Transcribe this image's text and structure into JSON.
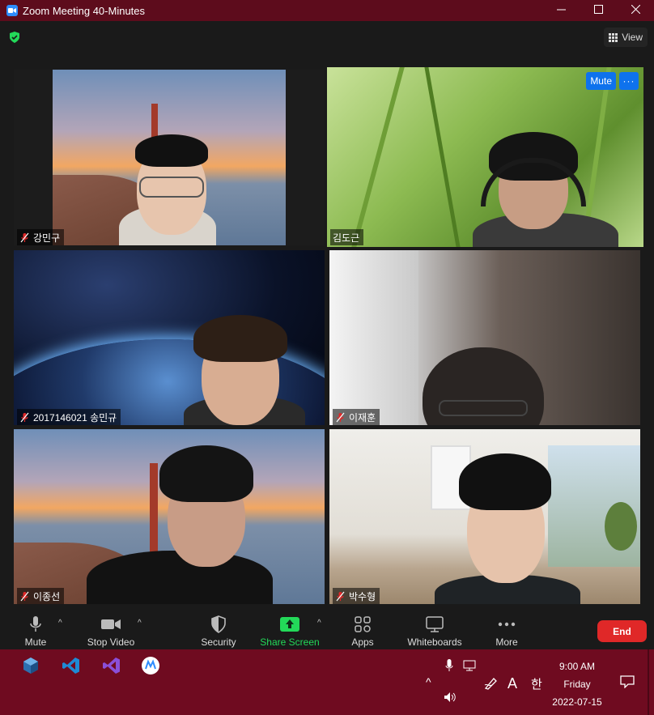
{
  "window": {
    "title": "Zoom Meeting 40-Minutes",
    "controls": [
      "minimize",
      "maximize",
      "close"
    ]
  },
  "header": {
    "view_label": "View"
  },
  "tiles": [
    {
      "name": "강민구",
      "muted": true,
      "active": false
    },
    {
      "name": "김도근",
      "muted": false,
      "active": true,
      "overlay": {
        "mute_label": "Mute",
        "more_label": "···"
      }
    },
    {
      "name": "2017146021 송민규",
      "muted": true,
      "active": false
    },
    {
      "name": "이재훈",
      "muted": true,
      "active": false
    },
    {
      "name": "이종선",
      "muted": true,
      "active": false
    },
    {
      "name": "박수형",
      "muted": true,
      "active": false
    }
  ],
  "toolbar": {
    "mute_label": "Mute",
    "video_label": "Stop Video",
    "security_label": "Security",
    "share_label": "Share Screen",
    "apps_label": "Apps",
    "whiteboards_label": "Whiteboards",
    "more_label": "More",
    "end_label": "End"
  },
  "taskbar": {
    "apps": [
      "virtualbox-icon",
      "vscode-icon",
      "visual-studio-icon",
      "app-icon"
    ],
    "tray": {
      "chevron": "^",
      "font_label": "A",
      "ime_label": "한"
    },
    "clock": {
      "time": "9:00 AM",
      "day": "Friday",
      "date": "2022-07-15"
    }
  },
  "colors": {
    "titlebar": "#5d0c1c",
    "taskbar": "#6f0b20",
    "active_speaker": "#e6ec8a",
    "end_button": "#e02828",
    "share_green": "#23d959",
    "zoom_blue": "#0e72ed"
  }
}
